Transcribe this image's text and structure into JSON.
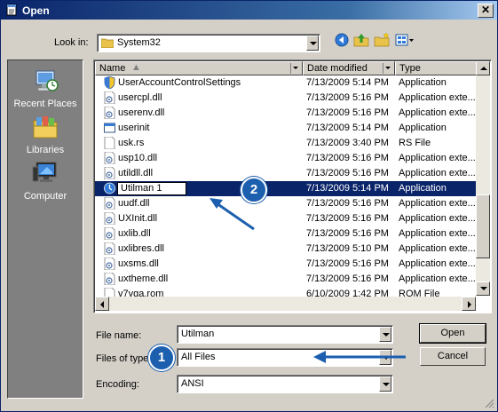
{
  "window": {
    "title": "Open",
    "close_glyph": "✕"
  },
  "toolbar": {
    "look_in_label": "Look in:",
    "look_in_value": "System32",
    "buttons": [
      "back-icon",
      "up-folder-icon",
      "new-folder-icon",
      "view-menu-icon"
    ]
  },
  "places": [
    {
      "label": "Recent Places",
      "icon": "recent-places-icon"
    },
    {
      "label": "Libraries",
      "icon": "libraries-icon"
    },
    {
      "label": "Computer",
      "icon": "computer-icon"
    }
  ],
  "columns": {
    "name": "Name",
    "date": "Date modified",
    "type": "Type"
  },
  "files": [
    {
      "name": "UserAccountControlSettings",
      "date": "7/13/2009 5:14 PM",
      "type": "Application",
      "icon": "shield-app-icon"
    },
    {
      "name": "usercpl.dll",
      "date": "7/13/2009 5:16 PM",
      "type": "Application exte...",
      "icon": "dll-icon"
    },
    {
      "name": "userenv.dll",
      "date": "7/13/2009 5:16 PM",
      "type": "Application exte...",
      "icon": "dll-icon"
    },
    {
      "name": "userinit",
      "date": "7/13/2009 5:14 PM",
      "type": "Application",
      "icon": "app-window-icon"
    },
    {
      "name": "usk.rs",
      "date": "7/13/2009 3:40 PM",
      "type": "RS File",
      "icon": "blank-file-icon"
    },
    {
      "name": "usp10.dll",
      "date": "7/13/2009 5:16 PM",
      "type": "Application exte...",
      "icon": "dll-icon"
    },
    {
      "name": "utildll.dll",
      "date": "7/13/2009 5:16 PM",
      "type": "Application exte...",
      "icon": "dll-icon"
    },
    {
      "name": "Utilman 1",
      "date": "7/13/2009 5:14 PM",
      "type": "Application",
      "icon": "utilman-icon",
      "selected": true,
      "renaming": true
    },
    {
      "name": "uudf.dll",
      "date": "7/13/2009 5:16 PM",
      "type": "Application exte...",
      "icon": "dll-icon"
    },
    {
      "name": "UXInit.dll",
      "date": "7/13/2009 5:16 PM",
      "type": "Application exte...",
      "icon": "dll-icon"
    },
    {
      "name": "uxlib.dll",
      "date": "7/13/2009 5:16 PM",
      "type": "Application exte...",
      "icon": "dll-icon"
    },
    {
      "name": "uxlibres.dll",
      "date": "7/13/2009 5:10 PM",
      "type": "Application exte...",
      "icon": "dll-icon"
    },
    {
      "name": "uxsms.dll",
      "date": "7/13/2009 5:16 PM",
      "type": "Application exte...",
      "icon": "dll-icon"
    },
    {
      "name": "uxtheme.dll",
      "date": "7/13/2009 5:16 PM",
      "type": "Application exte...",
      "icon": "dll-icon"
    },
    {
      "name": "v7vga.rom",
      "date": "6/10/2009 1:42 PM",
      "type": "ROM File",
      "icon": "blank-file-icon"
    }
  ],
  "form": {
    "file_name_label": "File name:",
    "file_name_value": "Utilman",
    "file_type_label": "Files of type:",
    "file_type_value": "All Files",
    "encoding_label": "Encoding:",
    "encoding_value": "ANSI"
  },
  "buttons": {
    "open": "Open",
    "cancel": "Cancel"
  },
  "annotations": [
    {
      "number": "1"
    },
    {
      "number": "2"
    }
  ],
  "colors": {
    "selection": "#0a246a",
    "annotation": "#1c5fae",
    "title_bar": "#0a246a"
  }
}
